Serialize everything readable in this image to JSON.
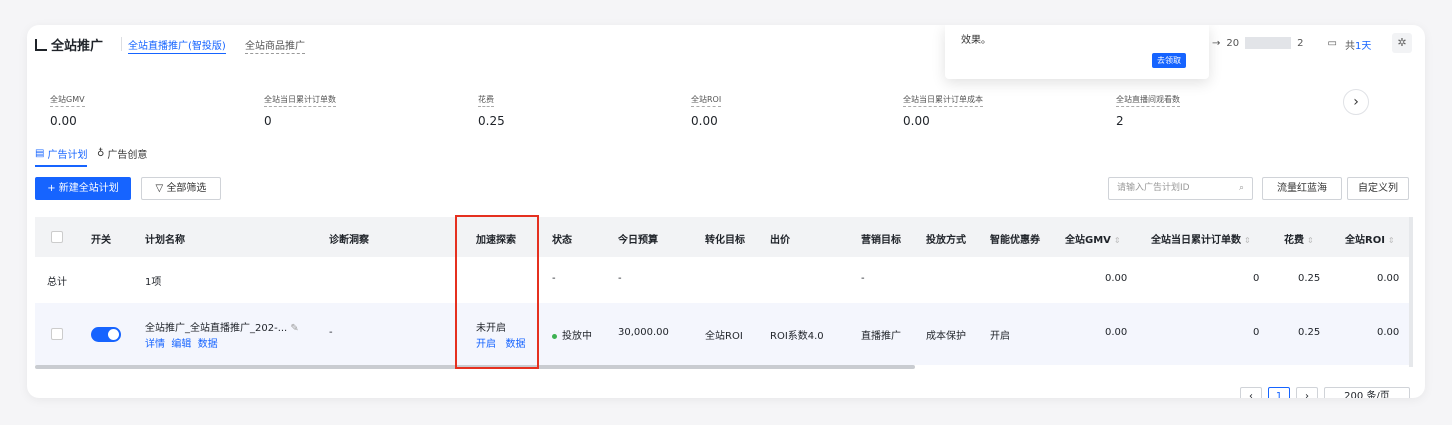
{
  "header": {
    "title": "全站推广",
    "tabs": [
      "全站直播推广(智投版)",
      "全站商品推广"
    ]
  },
  "popup": {
    "text": "效果。",
    "button": "去领取"
  },
  "date": {
    "arrow": "→",
    "start": "20",
    "end": "2",
    "total_prefix": "共",
    "total_days": "1天"
  },
  "metrics": [
    {
      "label": "全站GMV",
      "value": "0.00"
    },
    {
      "label": "全站当日累计订单数",
      "value": "0"
    },
    {
      "label": "花费",
      "value": "0.25"
    },
    {
      "label": "全站ROI",
      "value": "0.00"
    },
    {
      "label": "全站当日累计订单成本",
      "value": "0.00"
    },
    {
      "label": "全站直播间观看数",
      "value": "2"
    }
  ],
  "subtabs": [
    "广告计划",
    "广告创意"
  ],
  "toolbar": {
    "new_plan": "+ 新建全站计划",
    "filter": "全部筛选",
    "search_placeholder": "请输入广告计划ID",
    "traffic_button": "流量红蓝海",
    "custom_columns": "自定义列"
  },
  "table": {
    "headers": [
      "开关",
      "计划名称",
      "诊断洞察",
      "加速探索",
      "状态",
      "今日预算",
      "转化目标",
      "出价",
      "营销目标",
      "投放方式",
      "智能优惠券",
      "全站GMV",
      "全站当日累计订单数",
      "花费",
      "全站ROI"
    ],
    "total": {
      "label": "总计",
      "count": "1项",
      "status": "-",
      "budget": "-",
      "marketing": "-",
      "gmv": "0.00",
      "orders": "0",
      "cost": "0.25",
      "roi": "0.00"
    },
    "row": {
      "name": "全站推广_全站直播推广_202-...",
      "actions": [
        "详情",
        "编辑",
        "数据"
      ],
      "diagnosis": "-",
      "explore_status": "未开启",
      "explore_actions": [
        "开启",
        "数据"
      ],
      "status": "投放中",
      "budget": "30,000.00",
      "target": "全站ROI",
      "bid": "ROI系数4.0",
      "marketing": "直播推广",
      "delivery": "成本保护",
      "coupon": "开启",
      "gmv": "0.00",
      "orders": "0",
      "cost": "0.25",
      "roi": "0.00"
    }
  },
  "pager": {
    "current": "1",
    "page_size": "200 条/页"
  },
  "colors": {
    "accent": "#1664ff",
    "highlight": "#e5301f",
    "active_dot": "#3db152"
  }
}
